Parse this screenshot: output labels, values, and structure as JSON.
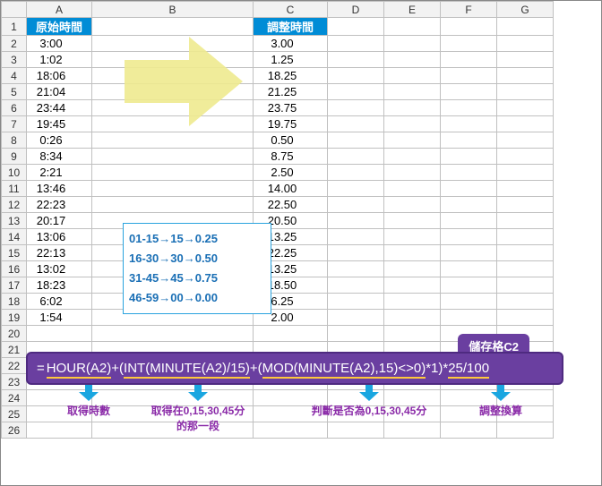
{
  "columns": {
    "A": "A",
    "B": "B",
    "C": "C",
    "D": "D",
    "E": "E",
    "F": "F",
    "G": "G"
  },
  "header": {
    "a": "原始時間",
    "c": "調整時間"
  },
  "rows": [
    {
      "n": "1"
    },
    {
      "n": "2",
      "a": "3:00",
      "c": "3.00"
    },
    {
      "n": "3",
      "a": "1:02",
      "c": "1.25"
    },
    {
      "n": "4",
      "a": "18:06",
      "c": "18.25"
    },
    {
      "n": "5",
      "a": "21:04",
      "c": "21.25"
    },
    {
      "n": "6",
      "a": "23:44",
      "c": "23.75"
    },
    {
      "n": "7",
      "a": "19:45",
      "c": "19.75"
    },
    {
      "n": "8",
      "a": "0:26",
      "c": "0.50"
    },
    {
      "n": "9",
      "a": "8:34",
      "c": "8.75"
    },
    {
      "n": "10",
      "a": "2:21",
      "c": "2.50"
    },
    {
      "n": "11",
      "a": "13:46",
      "c": "14.00"
    },
    {
      "n": "12",
      "a": "22:23",
      "c": "22.50"
    },
    {
      "n": "13",
      "a": "20:17",
      "c": "20.50"
    },
    {
      "n": "14",
      "a": "13:06",
      "c": "13.25"
    },
    {
      "n": "15",
      "a": "22:13",
      "c": "22.25"
    },
    {
      "n": "16",
      "a": "13:02",
      "c": "13.25"
    },
    {
      "n": "17",
      "a": "18:23",
      "c": "18.50"
    },
    {
      "n": "18",
      "a": "6:02",
      "c": "6.25"
    },
    {
      "n": "19",
      "a": "1:54",
      "c": "2.00"
    }
  ],
  "extraRows": [
    "20",
    "21",
    "22",
    "23",
    "24",
    "25",
    "26"
  ],
  "rules": {
    "l1": "01-15→15→0.25",
    "l2": "16-30→30→0.50",
    "l3": "31-45→45→0.75",
    "l4": "46-59→00→0.00"
  },
  "celltag": "儲存格C2",
  "formula": {
    "eq": "=",
    "s1": "HOUR(A2)",
    "p1": "+(",
    "s2": "INT(MINUTE(A2)/15)",
    "p2": "+(",
    "s3": "MOD(MINUTE(A2),15)<>0)",
    "p3": "*1)*",
    "s4": "25/100"
  },
  "annotations": {
    "a1": "取得時數",
    "a2": "取得在0,15,30,45分",
    "a2b": "的那一段",
    "a3": "判斷是否為0,15,30,45分",
    "a4": "調整換算"
  }
}
